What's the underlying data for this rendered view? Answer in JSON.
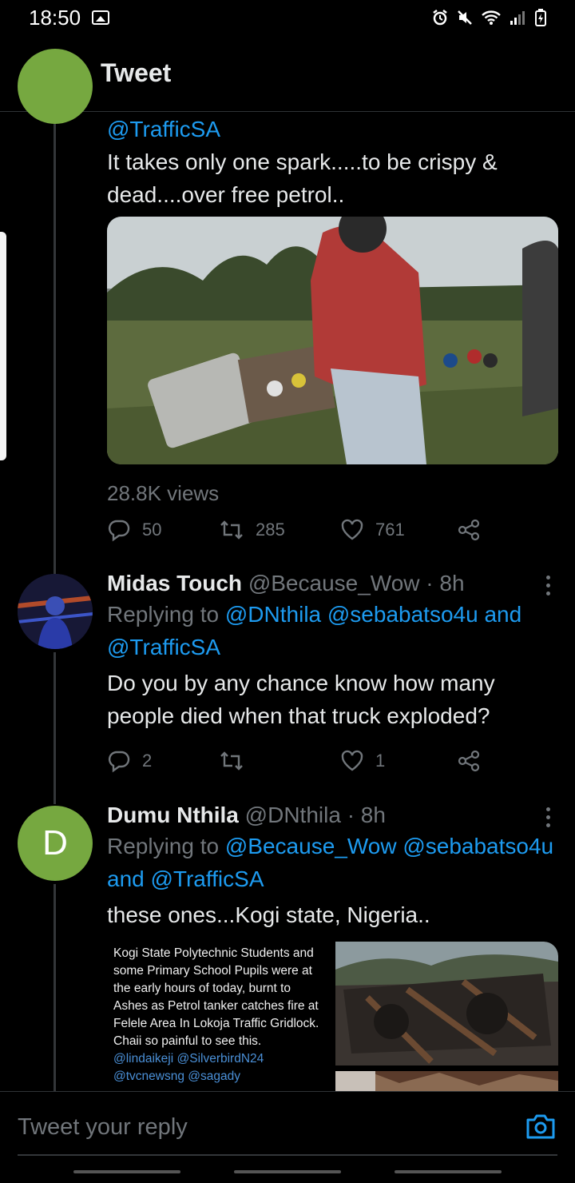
{
  "status_bar": {
    "time": "18:50"
  },
  "header": {
    "title": "Tweet"
  },
  "tweet1": {
    "mention": "@TrafficSA",
    "text": "It takes only one spark.....to be crispy & dead....over free petrol..",
    "views": "28.8K views",
    "replies": "50",
    "retweets": "285",
    "likes": "761",
    "avatar_color": "#76a840"
  },
  "tweet2": {
    "name": "Midas Touch",
    "handle": "@Because_Wow",
    "time": "· 8h",
    "replying_label": "Replying to",
    "replying_to": "@DNthila @sebabatso4u and @TrafficSA",
    "text": "Do you by any chance know how many people died when that truck exploded?",
    "replies": "2",
    "retweets": "",
    "likes": "1"
  },
  "tweet3": {
    "name": "Dumu Nthila",
    "handle": "@DNthila",
    "time": "· 8h",
    "avatar_letter": "D",
    "avatar_color": "#76a840",
    "replying_label": "Replying to",
    "replying_to": "@Because_Wow @sebabatso4u and @TrafficSA",
    "text": "these ones...Kogi state, Nigeria..",
    "image_caption": "Kogi State Polytechnic Students and some Primary School Pupils were at the early hours of today, burnt to Ashes as Petrol tanker catches fire at Felele Area In Lokoja Traffic Gridlock. Chaii so painful to see this.",
    "image_caption_mentions": "@lindaikeji @SilverbirdN24 @tvcnewsng @sagady"
  },
  "reply_bar": {
    "placeholder": "Tweet your reply"
  },
  "colors": {
    "accent": "#1d9bf0",
    "muted": "#71767b",
    "background": "#000000"
  }
}
